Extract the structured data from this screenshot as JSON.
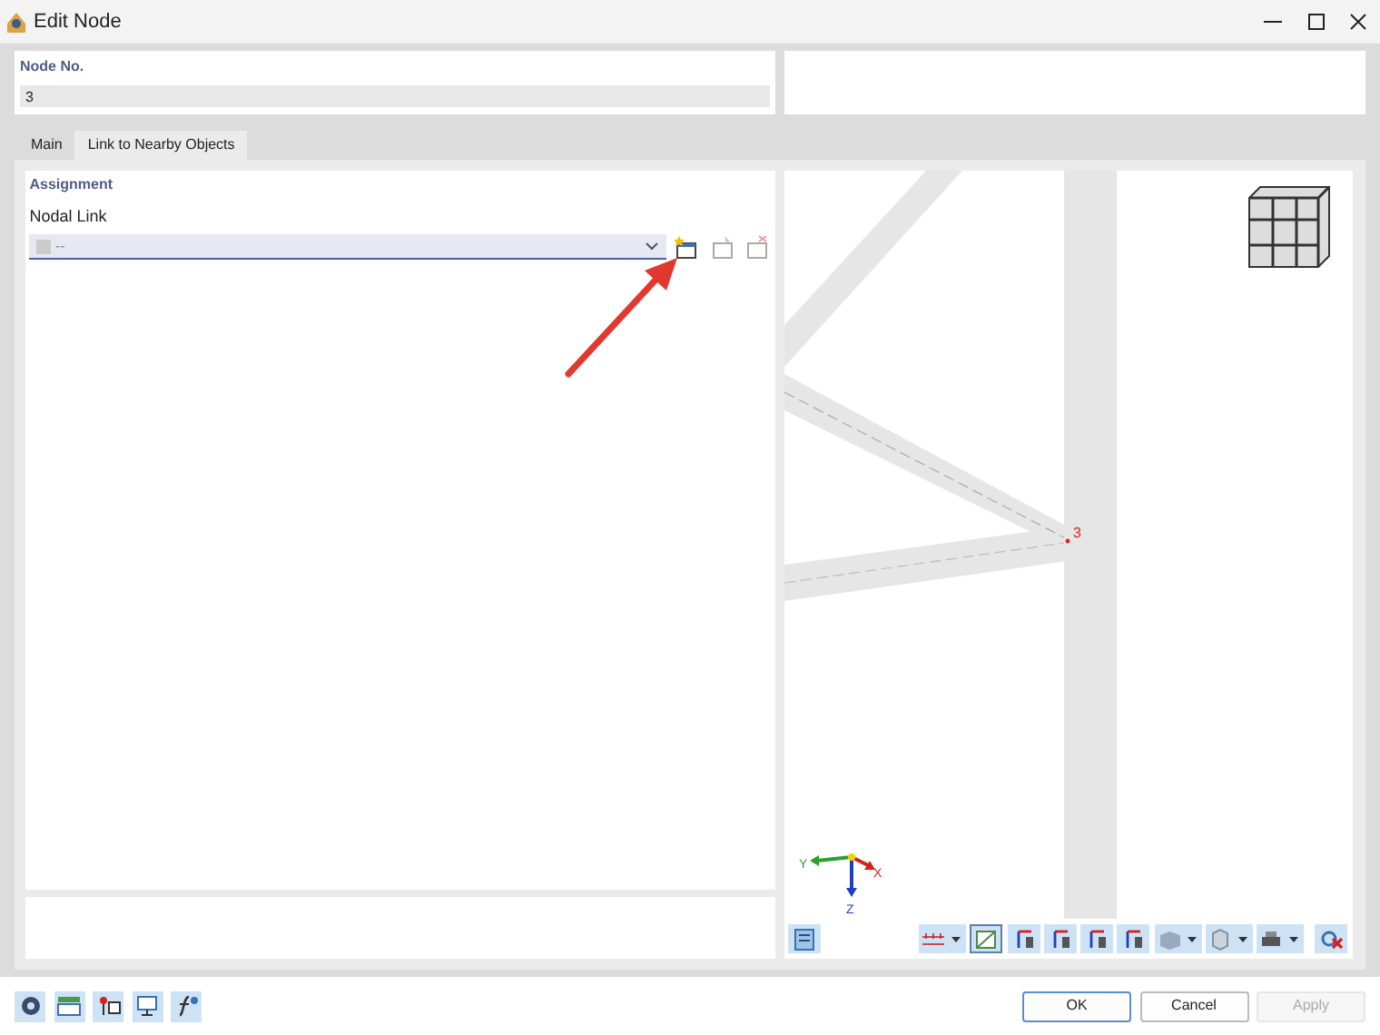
{
  "window": {
    "title": "Edit Node"
  },
  "node_no": {
    "label": "Node No.",
    "value": "3"
  },
  "tabs": [
    {
      "label": "Main",
      "selected": false
    },
    {
      "label": "Link to Nearby Objects",
      "selected": true
    }
  ],
  "assignment": {
    "title": "Assignment",
    "nodal_link": {
      "label": "Nodal Link",
      "value": "--"
    },
    "link_buttons": [
      {
        "kind": "new",
        "disabled": false
      },
      {
        "kind": "edit",
        "disabled": true
      },
      {
        "kind": "delete",
        "disabled": true
      }
    ]
  },
  "viewport": {
    "node_label": "3",
    "axis_labels": [
      "Y",
      "X",
      "Z"
    ]
  },
  "buttons": [
    {
      "label": "OK",
      "disabled": false
    },
    {
      "label": "Cancel",
      "disabled": false
    },
    {
      "label": "Apply",
      "disabled": true
    }
  ]
}
